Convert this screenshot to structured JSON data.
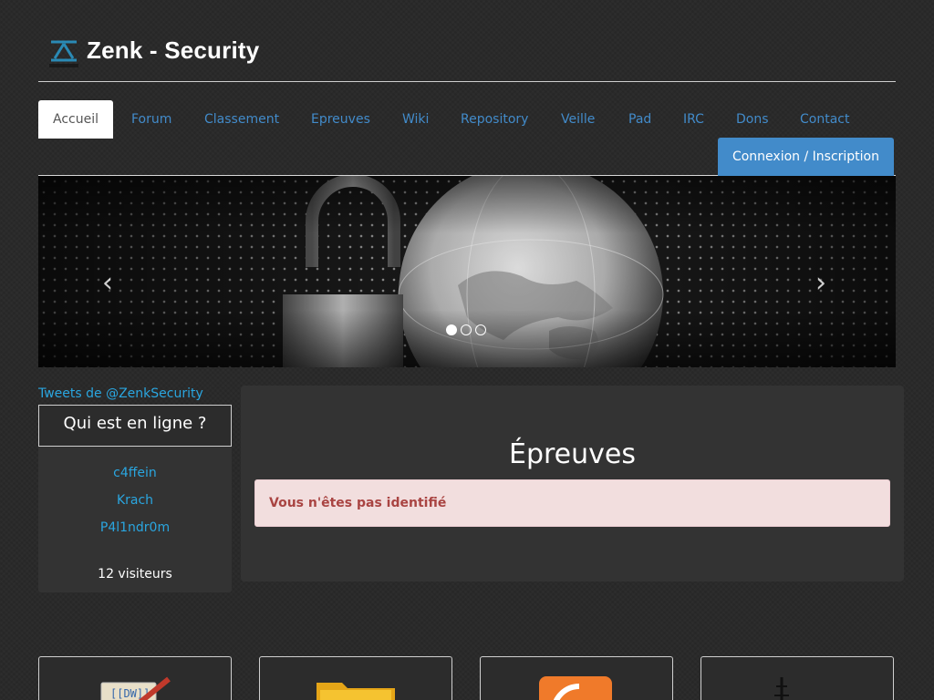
{
  "header": {
    "brand": "Zenk - Security"
  },
  "nav": {
    "tabs": [
      {
        "label": "Accueil",
        "active": true
      },
      {
        "label": "Forum"
      },
      {
        "label": "Classement"
      },
      {
        "label": "Epreuves"
      },
      {
        "label": "Wiki"
      },
      {
        "label": "Repository"
      },
      {
        "label": "Veille"
      },
      {
        "label": "Pad"
      },
      {
        "label": "IRC"
      },
      {
        "label": "Dons"
      },
      {
        "label": "Contact"
      }
    ],
    "login_label": "Connexion / Inscription"
  },
  "carousel": {
    "prev_icon": "chevron-left-icon",
    "next_icon": "chevron-right-icon",
    "slides": 3,
    "active_slide": 1
  },
  "sidebar": {
    "tweets_link": "Tweets de @ZenkSecurity",
    "online_title": "Qui est en ligne ?",
    "users": [
      "c4ffein",
      "Krach",
      "P4l1ndr0m"
    ],
    "visitors": "12 visiteurs"
  },
  "main": {
    "title": "Épreuves",
    "alert": "Vous n'êtes pas identifié"
  },
  "tiles": [
    {
      "icon": "dokuwiki-icon"
    },
    {
      "icon": "folder-icon"
    },
    {
      "icon": "rss-icon"
    },
    {
      "icon": "antenna-icon"
    }
  ],
  "colors": {
    "link": "#428bca",
    "accent_button": "#428bca",
    "alert_bg": "#f2dede",
    "alert_text": "#a94442"
  }
}
